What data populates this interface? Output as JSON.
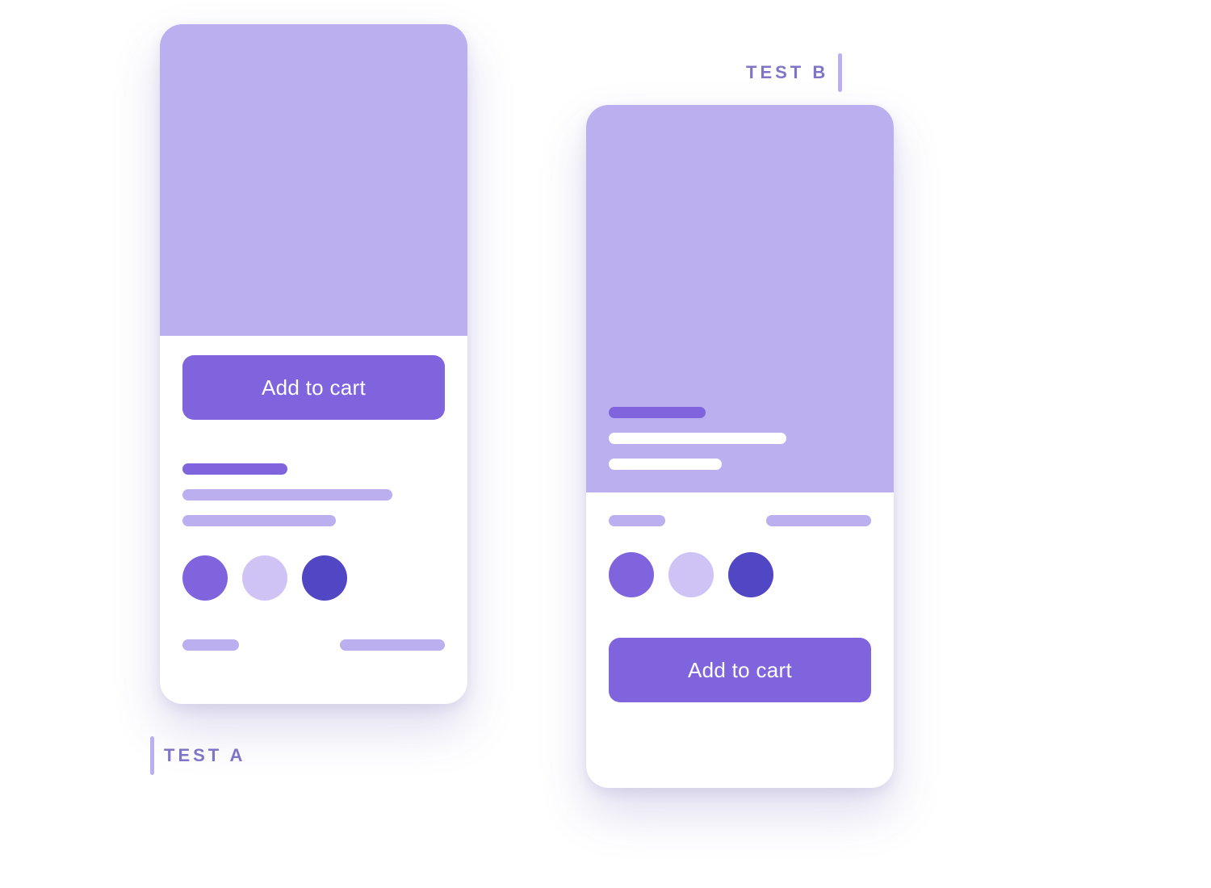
{
  "labels": {
    "a": "TEST A",
    "b": "TEST B"
  },
  "button": {
    "add_to_cart": "Add to cart"
  },
  "swatches": {
    "primary": "#8064dd",
    "secondary": "#cfc3f6",
    "tertiary": "#5146c4"
  }
}
